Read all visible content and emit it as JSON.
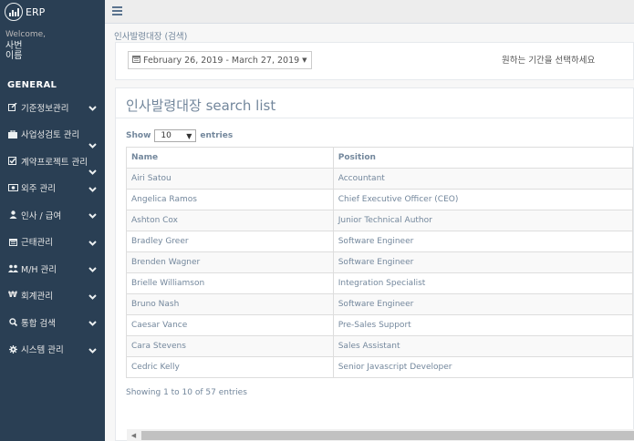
{
  "app": {
    "brand": "ERP"
  },
  "user": {
    "welcome": "Welcome,",
    "name": "사번\n이름"
  },
  "sidebar": {
    "section": "GENERAL",
    "items": [
      {
        "label": "기준정보관리",
        "icon": "edit-icon"
      },
      {
        "label": "사업성검토 관리",
        "icon": "briefcase-icon"
      },
      {
        "label": "계약프로젝트 관리",
        "icon": "check-square-icon"
      },
      {
        "label": "외주 관리",
        "icon": "money-icon"
      },
      {
        "label": "인사 / 급여",
        "icon": "user-icon"
      },
      {
        "label": "근태관리",
        "icon": "calendar-icon"
      },
      {
        "label": "M/H 관리",
        "icon": "users-icon"
      },
      {
        "label": "회계관리",
        "icon": "won-icon"
      },
      {
        "label": "통합 검색",
        "icon": "search-icon"
      },
      {
        "label": "시스템 관리",
        "icon": "gear-icon"
      }
    ]
  },
  "breadcrumb": "인사발령대장 (검색)",
  "filter": {
    "date_range": "February 26, 2019 - March 27, 2019",
    "hint": "원하는 기간을 선택하세요"
  },
  "panel": {
    "title": "인사발령대장 search list",
    "show_label": "Show",
    "entries_value": "10",
    "entries_label": "entries",
    "columns": [
      "Name",
      "Position"
    ],
    "rows": [
      [
        "Airi Satou",
        "Accountant"
      ],
      [
        "Angelica Ramos",
        "Chief Executive Officer (CEO)"
      ],
      [
        "Ashton Cox",
        "Junior Technical Author"
      ],
      [
        "Bradley Greer",
        "Software Engineer"
      ],
      [
        "Brenden Wagner",
        "Software Engineer"
      ],
      [
        "Brielle Williamson",
        "Integration Specialist"
      ],
      [
        "Bruno Nash",
        "Software Engineer"
      ],
      [
        "Caesar Vance",
        "Pre-Sales Support"
      ],
      [
        "Cara Stevens",
        "Sales Assistant"
      ],
      [
        "Cedric Kelly",
        "Senior Javascript Developer"
      ]
    ],
    "info": "Showing 1 to 10 of 57 entries"
  },
  "colors": {
    "sidebar": "#2a3f54",
    "text": "#73879c",
    "topbar": "#ededed"
  }
}
